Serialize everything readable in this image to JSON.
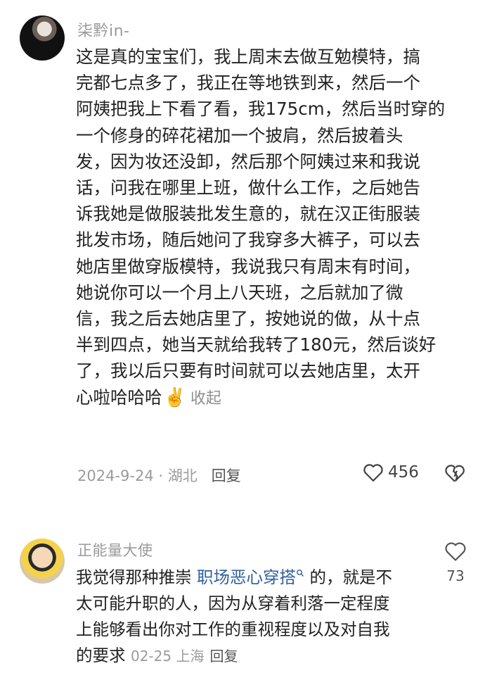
{
  "comments": [
    {
      "username": "柒黔in-",
      "lines": [
        "这是真的宝宝们，我上周末去做互勉模特，搞",
        "完都七点多了，我正在等地铁到来，然后一个",
        "阿姨把我上下看了看，我175cm，然后当时穿的",
        "一个修身的碎花裙加一个披肩，然后披着头",
        "发，因为妆还没卸，然后那个阿姨过来和我说",
        "话，问我在哪里上班，做什么工作，之后她告",
        "诉我她是做服装批发生意的，就在汉正街服装",
        "批发市场，随后她问了我穿多大裤子，可以去",
        "她店里做穿版模特，我说我只有周末有时间，",
        "她说你可以一个月上八天班，之后就加了微",
        "信，我之后去她店里了，按她说的做，从十点",
        "半到四点，她当天就给我转了180元，然后谈好",
        "了，我以后只要有时间就可以去她店里，太开"
      ],
      "last_line": "心啦哈哈哈",
      "emoji": "✌️",
      "collapse_label": "收起",
      "date_location": "2024-9-24 · 湖北",
      "reply_label": "回复",
      "like_count": "456"
    },
    {
      "username": "正能量大使",
      "line1_prefix": "我觉得那种推崇 ",
      "link_text": "职场恶心穿搭",
      "link_icon": "search-icon",
      "line1_suffix": " 的，就是不",
      "lines": [
        "太可能升职的人，因为从穿着利落一定程度",
        "上能够看出你对工作的重视程度以及对自我"
      ],
      "last_line": "的要求",
      "date_location": "02-25 上海",
      "reply_label": "回复",
      "like_count": "73"
    }
  ],
  "colors": {
    "username": "#9a9a9a",
    "link": "#2f5f9d",
    "meta": "#9b9b9b"
  }
}
